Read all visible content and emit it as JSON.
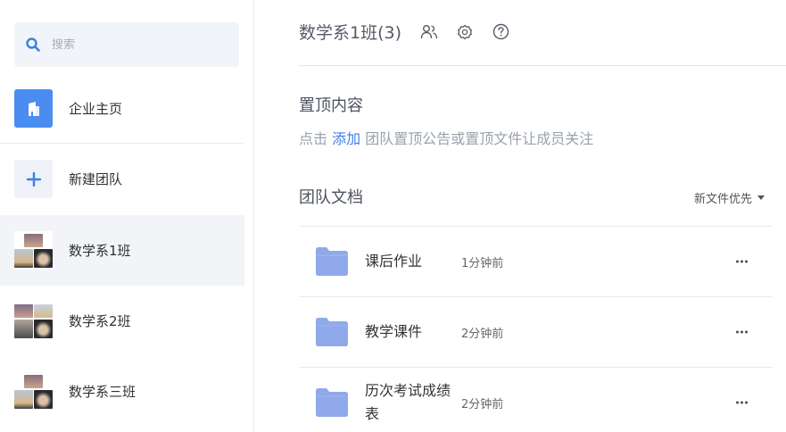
{
  "sidebar": {
    "search_placeholder": "搜索",
    "items": [
      {
        "label": "企业主页",
        "icon": "building-icon"
      },
      {
        "label": "新建团队",
        "icon": "plus-icon"
      },
      {
        "label": "数学系1班",
        "icon": "team-avatar-collage",
        "active": true
      },
      {
        "label": "数学系2班",
        "icon": "team-avatar-collage"
      },
      {
        "label": "数学系三班",
        "icon": "team-avatar-collage"
      }
    ]
  },
  "header": {
    "title": "数学系1班(3)",
    "icons": [
      "members-icon",
      "settings-icon",
      "help-icon"
    ]
  },
  "pinned": {
    "title": "置顶内容",
    "hint_prefix": "点击",
    "hint_link": "添加",
    "hint_suffix": "团队置顶公告或置顶文件让成员关注"
  },
  "docs": {
    "title": "团队文档",
    "sort_label": "新文件优先",
    "rows": [
      {
        "name": "课后作业",
        "time": "1分钟前"
      },
      {
        "name": "教学课件",
        "time": "2分钟前"
      },
      {
        "name": "历次考试成绩表",
        "time": "2分钟前"
      }
    ]
  },
  "colors": {
    "accent": "#3d7fe6",
    "folder": "#8fa9ea",
    "active_bg": "#f2f4f8"
  }
}
